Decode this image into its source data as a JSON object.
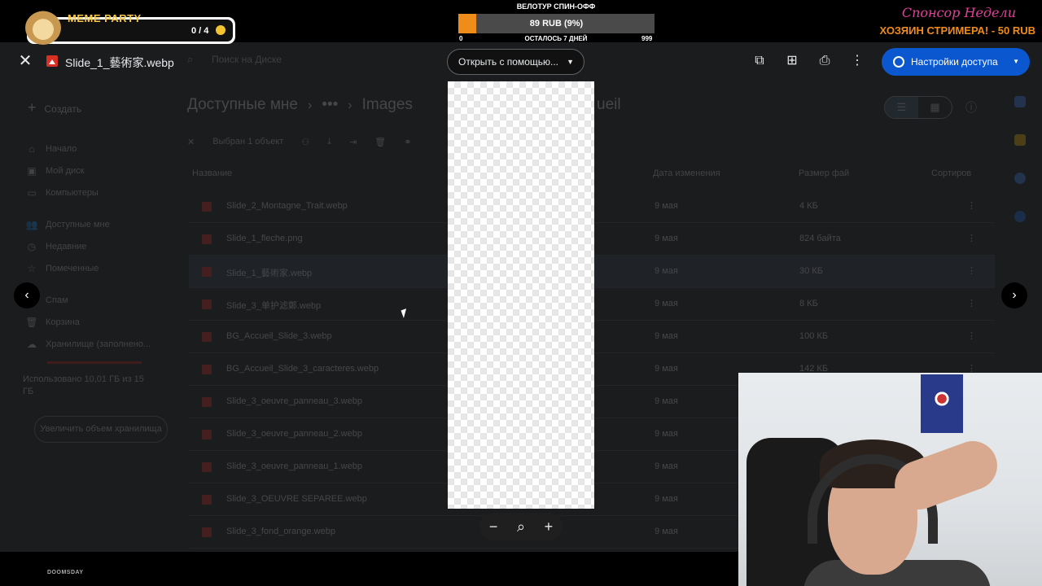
{
  "viewer": {
    "file_title": "Slide_1_藝術家.webp",
    "open_with_label": "Открыть с помощью...",
    "share_label": "Настройки доступа",
    "zoom_minus": "−",
    "zoom_plus": "+",
    "prev": "‹",
    "next": "›"
  },
  "drive": {
    "search_placeholder": "Поиск на Диске",
    "create_label": "Создать",
    "sidebar": [
      {
        "icon": "⌂",
        "label": "Начало"
      },
      {
        "icon": "▣",
        "label": "Мой диск"
      },
      {
        "icon": "▭",
        "label": "Компьютеры"
      },
      {
        "icon": "👥",
        "label": "Доступные мне"
      },
      {
        "icon": "◷",
        "label": "Недавние"
      },
      {
        "icon": "☆",
        "label": "Помеченные"
      },
      {
        "icon": "⊘",
        "label": "Спам"
      },
      {
        "icon": "🗑",
        "label": "Корзина"
      },
      {
        "icon": "☁",
        "label": "Хранилище (заполнено..."
      }
    ],
    "storage_text": "Использовано 10,01 ГБ из 15 ГБ",
    "more_storage": "Увеличить объем хранилища",
    "breadcrumb_root": "Доступные мне",
    "breadcrumb_dots": "•••",
    "breadcrumb_folder": "Images",
    "breadcrumb_tail": "ueil",
    "selection_text": "Выбран 1 объект",
    "columns": {
      "name": "Название",
      "modified": "Дата изменения",
      "size": "Размер фай",
      "sort": "Сортиров"
    },
    "files": [
      {
        "name": "Slide_2_Montagne_Trait.webp",
        "date": "9 мая",
        "size": "4 КБ"
      },
      {
        "name": "Slide_1_fleche.png",
        "date": "9 мая",
        "size": "824 байта"
      },
      {
        "name": "Slide_1_藝術家.webp",
        "date": "9 мая",
        "size": "30 КБ"
      },
      {
        "name": "Slide_3_单护滤鄭.webp",
        "date": "9 мая",
        "size": "8 КБ"
      },
      {
        "name": "BG_Accueil_Slide_3.webp",
        "date": "9 мая",
        "size": "100 КБ"
      },
      {
        "name": "BG_Accueil_Slide_3_caracteres.webp",
        "date": "9 мая",
        "size": "142 КБ"
      },
      {
        "name": "Slide_3_oeuvre_panneau_3.webp",
        "date": "9 мая",
        "size": ""
      },
      {
        "name": "Slide_3_oeuvre_panneau_2.webp",
        "date": "9 мая",
        "size": ""
      },
      {
        "name": "Slide_3_oeuvre_panneau_1.webp",
        "date": "9 мая",
        "size": ""
      },
      {
        "name": "Slide_3_OEUVRE SEPAREE.webp",
        "date": "9 мая",
        "size": ""
      },
      {
        "name": "Slide_3_fond_orange.webp",
        "date": "9 мая",
        "size": ""
      }
    ]
  },
  "overlay": {
    "meme_title": "MEME PARTY",
    "meme_count": "0 / 4",
    "goal_title": "ВЕЛОТУР СПИН-ОФФ",
    "goal_value": "89 RUB (9%)",
    "goal_progress": 0.09,
    "goal_min": "0",
    "goal_left": "ОСТАЛОСЬ 7 ДНЕЙ",
    "goal_max": "999",
    "sponsor_title": "Спонсор Недели",
    "sponsor_text": "ХОЗЯИН СТРИМЕРА! - 50 RUB",
    "logo_text": "DOOMSDAY"
  },
  "colors": {
    "share_blue": "#0b57d0",
    "accent_orange": "#f08c1a",
    "sponsor_pink": "#e0409a",
    "file_icon_red": "#d93025"
  }
}
